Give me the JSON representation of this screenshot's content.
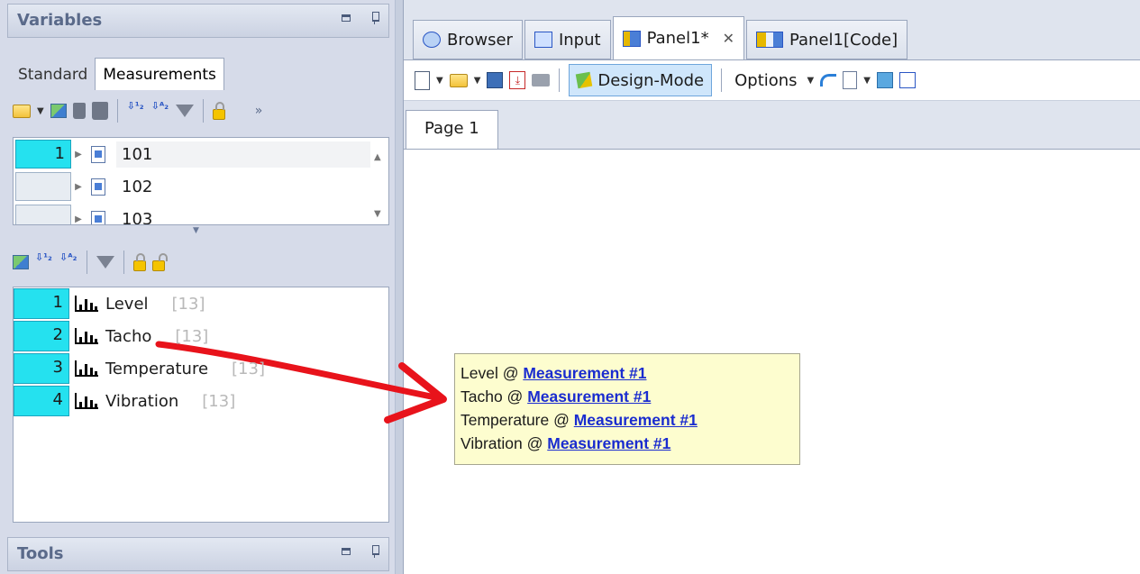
{
  "variables_pane": {
    "title": "Variables",
    "tabs": [
      {
        "label": "Standard",
        "active": false
      },
      {
        "label": "Measurements",
        "active": true
      }
    ],
    "measurements": [
      {
        "index": "1",
        "name": "101",
        "selected": true
      },
      {
        "index": "",
        "name": "102",
        "selected": false
      },
      {
        "index": "",
        "name": "103",
        "selected": false
      }
    ],
    "channels": [
      {
        "index": "1",
        "name": "Level",
        "count": "[13]"
      },
      {
        "index": "2",
        "name": "Tacho",
        "count": "[13]"
      },
      {
        "index": "3",
        "name": "Temperature",
        "count": "[13]"
      },
      {
        "index": "4",
        "name": "Vibration",
        "count": "[13]"
      }
    ]
  },
  "tools_pane": {
    "title": "Tools"
  },
  "document_tabs": [
    {
      "label": "Browser",
      "icon": "browser-icon",
      "active": false
    },
    {
      "label": "Input",
      "icon": "input-icon",
      "active": false
    },
    {
      "label": "Panel1*",
      "icon": "panel-icon",
      "active": true,
      "closable": true
    },
    {
      "label": "Panel1[Code]",
      "icon": "panel-code-icon",
      "active": false
    }
  ],
  "panel_toolbar": {
    "design_mode_label": "Design-Mode",
    "options_label": "Options"
  },
  "page_tab": {
    "label": "Page 1"
  },
  "data_box": {
    "lines": [
      {
        "prefix": "Level @ ",
        "link": "Measurement #1"
      },
      {
        "prefix": "Tacho @ ",
        "link": "Measurement #1"
      },
      {
        "prefix": "Temperature @ ",
        "link": "Measurement #1"
      },
      {
        "prefix": "Vibration @ ",
        "link": "Measurement #1"
      }
    ]
  },
  "colors": {
    "selected_index": "#25e1ef",
    "annotation_arrow": "#e8131b",
    "link": "#1a2ccf",
    "data_box_bg": "#fdfdcf"
  }
}
